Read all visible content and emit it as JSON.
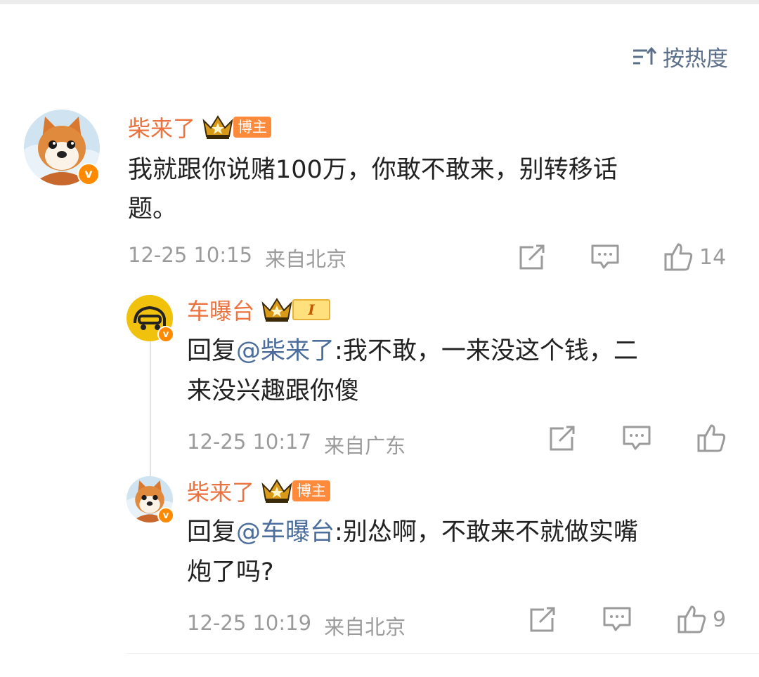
{
  "sort": {
    "label": "按热度",
    "icon": "sort-icon"
  },
  "comments": [
    {
      "username": "柴来了",
      "rank_label": "博主",
      "text": "我就跟你说赌100万，你敢不敢来，别转移话题。",
      "line1": "我就跟你说赌100万，你敢不敢来，别转移话",
      "line2": "题。",
      "time": "12-25 10:15",
      "location": "来自北京",
      "like_count": "14"
    }
  ],
  "replies": [
    {
      "username": "车曝台",
      "level": "I",
      "prefix": "回复",
      "mention": "@柴来了",
      "line1_rest": ":我不敢，一来没这个钱，二",
      "line2": "来没兴趣跟你傻",
      "time": "12-25 10:17",
      "location": "来自广东",
      "like_count": ""
    },
    {
      "username": "柴来了",
      "rank_label": "博主",
      "prefix": "回复",
      "mention": "@车曝台",
      "line1_rest": ":别怂啊，不敢来不就做实嘴",
      "line2": "炮了吗?",
      "time": "12-25 10:19",
      "location": "来自北京",
      "like_count": "9"
    }
  ],
  "colors": {
    "username": "#eb7340",
    "mention": "#4c6e9c",
    "meta": "#9b9b9b",
    "verified_badge": "#ff8a00",
    "sort_text": "#5c6f8a"
  },
  "icons": [
    "crown-icon",
    "verified-icon",
    "share-icon",
    "comment-icon",
    "like-icon"
  ]
}
